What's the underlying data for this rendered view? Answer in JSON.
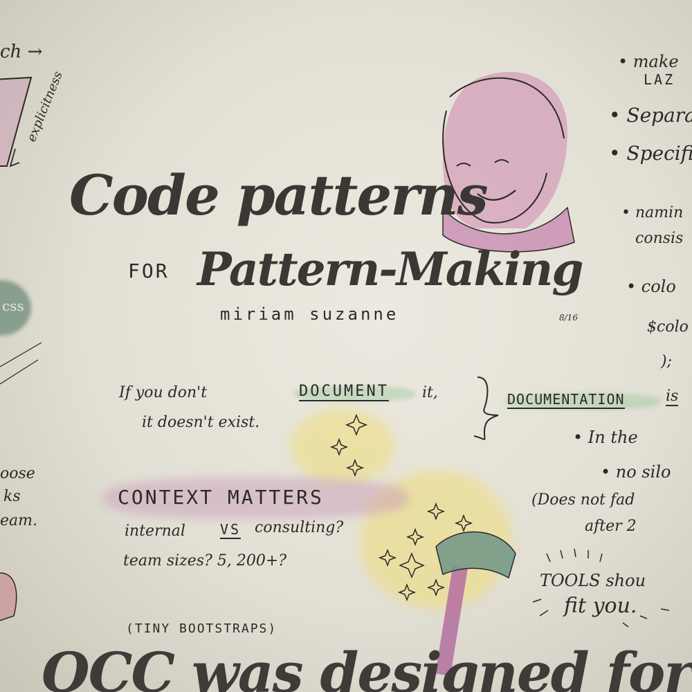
{
  "title": {
    "line1": "Code patterns",
    "for": "FOR",
    "line2": "Pattern-Making",
    "author": "miriam   suzanne",
    "date": "8/16"
  },
  "quote": {
    "line1a": "If you don't",
    "document": "DOCUMENT",
    "line1b": "it,",
    "line2": "it doesn't exist."
  },
  "documentation": {
    "head": "DOCUMENTATION",
    "is": "is",
    "b1": "• In the",
    "b2": "• no silo",
    "b3": "(Does not fad",
    "b4": "after 2"
  },
  "context": {
    "head": "CONTEXT MATTERS",
    "line1a": "internal",
    "vs": "VS",
    "line1b": "consulting?",
    "line2": "team sizes? 5, 200+?",
    "tiny": "(TINY BOOTSTRAPS)"
  },
  "tools": {
    "line1": "TOOLS shou",
    "line2": "fit you."
  },
  "right_list": {
    "i1a": "• make",
    "i1b": "LAZ",
    "i2": "• Separa",
    "i3": "• Specifi",
    "i4a": "• namin",
    "i4b": "consis",
    "i5a": "• colo",
    "i5b": "$colo",
    "i5c": ");"
  },
  "left_edge": {
    "top": "ch →",
    "side": "explicitness",
    "badge": "css",
    "l1": "oose",
    "l2": "ks",
    "l3": "eam."
  },
  "bottom": {
    "text": "OCC was designed for Patterns"
  },
  "colors": {
    "paper": "#e6e3d8",
    "ink": "#2c2926",
    "pink": "#c98fb5",
    "yellow": "#ecd978",
    "green": "#a9cda9"
  }
}
